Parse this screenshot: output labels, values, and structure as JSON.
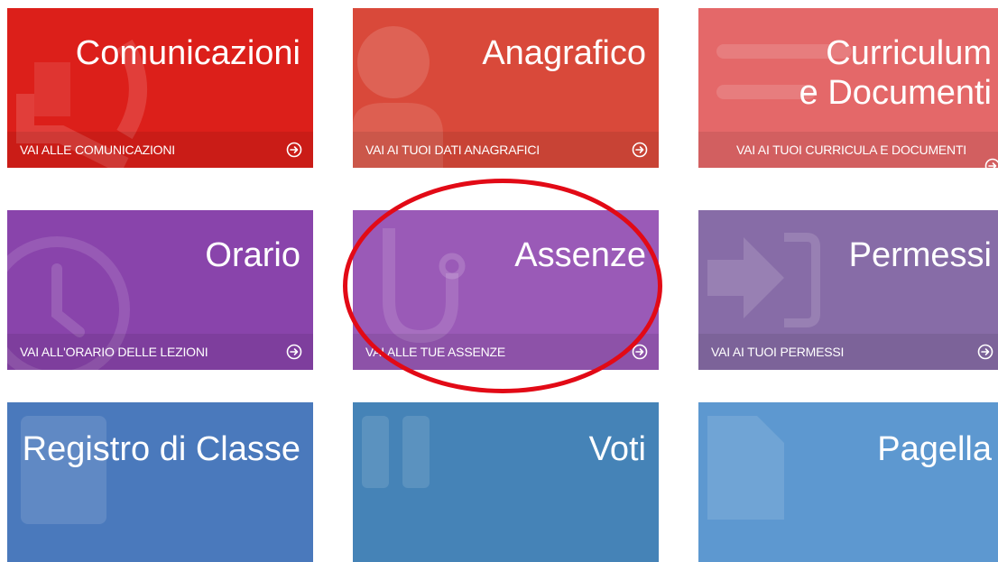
{
  "tiles": [
    {
      "title": "Comunicazioni",
      "link": "VAI ALLE COMUNICAZIONI",
      "icon": "megaphone-icon",
      "color": "#dc1f1a"
    },
    {
      "title": "Anagrafico",
      "link": "VAI AI TUOI DATI ANAGRAFICI",
      "icon": "user-icon",
      "color": "#d9493a"
    },
    {
      "title_line1": "Curriculum",
      "title_line2": "e Documenti",
      "link": "VAI AI TUOI CURRICULA E DOCUMENTI",
      "icon": "document-lines-icon",
      "color": "#e46869"
    },
    {
      "title": "Orario",
      "link": "VAI ALL'ORARIO DELLE LEZIONI",
      "icon": "clock-icon",
      "color": "#8944ab"
    },
    {
      "title": "Assenze",
      "link": "VAI ALLE TUE ASSENZE",
      "icon": "stethoscope-icon",
      "color": "#9a5ab7"
    },
    {
      "title": "Permessi",
      "link": "VAI AI TUOI PERMESSI",
      "icon": "exit-arrow-icon",
      "color": "#876ca7"
    },
    {
      "title": "Registro di Classe",
      "icon": "book-icon",
      "color": "#4a79bc"
    },
    {
      "title": "Voti",
      "icon": "number-icon",
      "color": "#4583b7"
    },
    {
      "title": "Pagella",
      "icon": "report-card-icon",
      "color": "#5d98d0"
    }
  ],
  "annotation": {
    "highlight_color": "#e20a16",
    "highlighted_tile": "Assenze"
  }
}
